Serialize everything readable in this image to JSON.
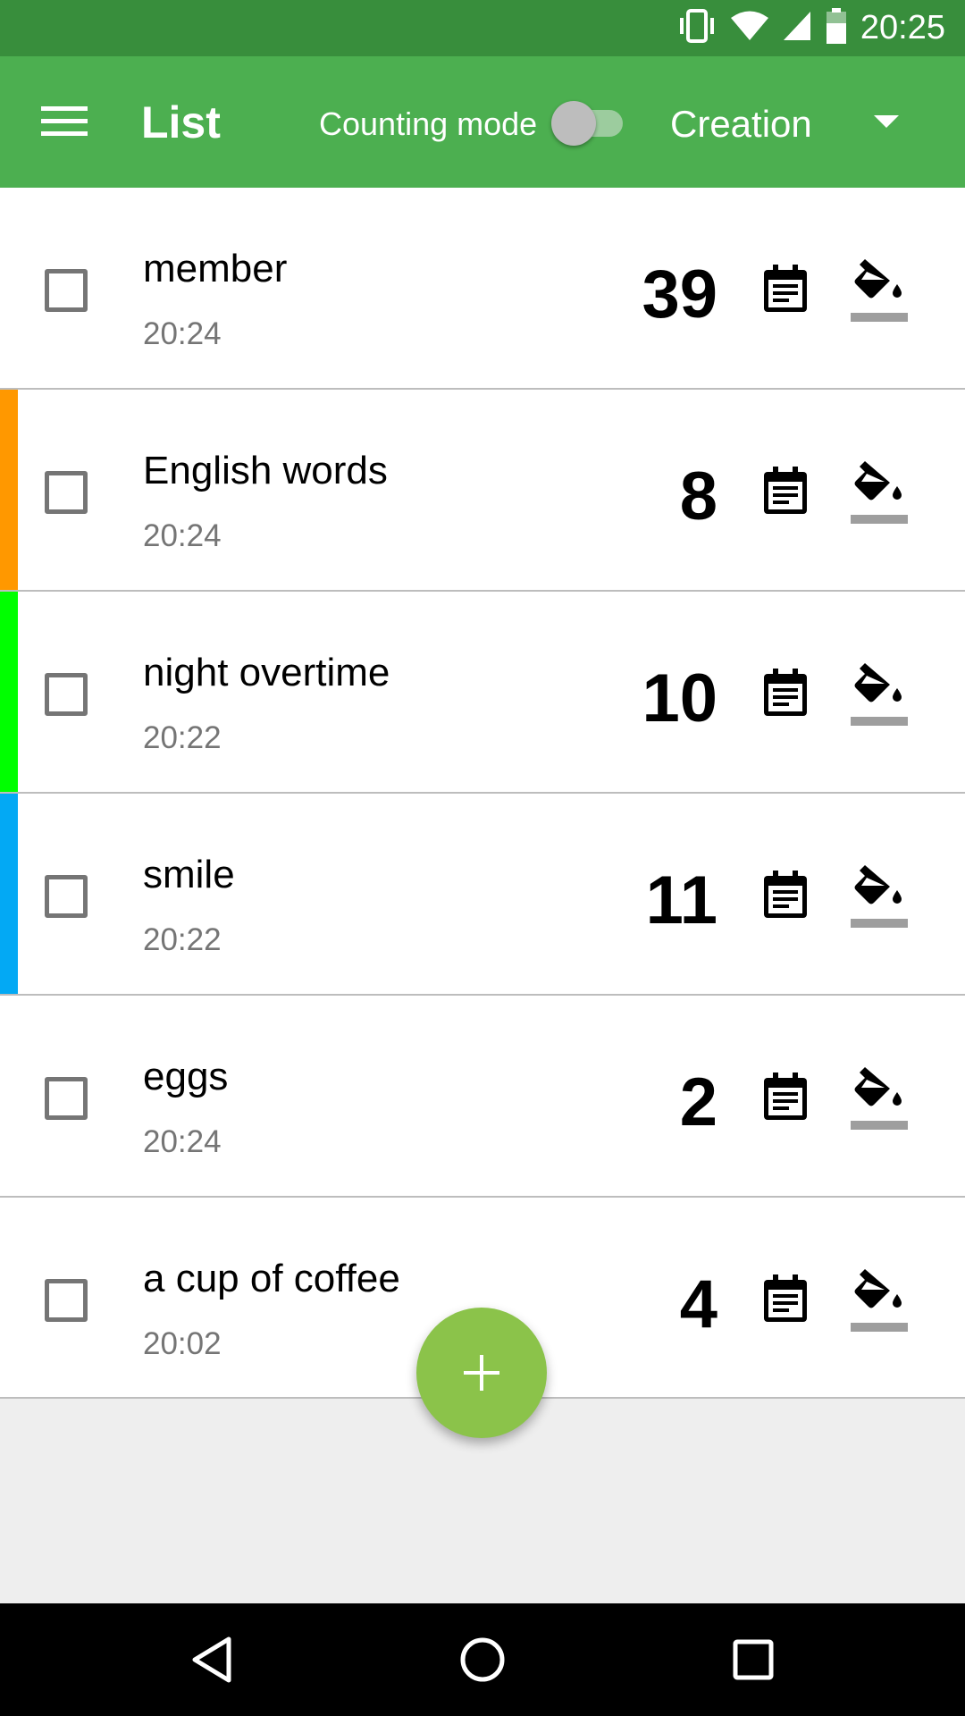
{
  "status_bar": {
    "time": "20:25",
    "icons": [
      "vibrate-icon",
      "wifi-icon",
      "signal-icon",
      "battery-icon"
    ]
  },
  "app_bar": {
    "menu_icon": "hamburger-menu-icon",
    "title": "List",
    "counting_mode_label": "Counting mode",
    "counting_mode_on": false,
    "sort_value": "Creation",
    "colors": {
      "status_bar": "#388e3c",
      "app_bar": "#4caf50"
    }
  },
  "items": [
    {
      "name": "member",
      "time": "20:24",
      "count": "39",
      "color": ""
    },
    {
      "name": "English words",
      "time": "20:24",
      "count": "8",
      "color": "#ff9800"
    },
    {
      "name": "night overtime",
      "time": "20:22",
      "count": "10",
      "color": "#00ff00"
    },
    {
      "name": "smile",
      "time": "20:22",
      "count": "11",
      "color": "#03a9f4"
    },
    {
      "name": "eggs",
      "time": "20:24",
      "count": "2",
      "color": ""
    },
    {
      "name": "a cup of coffee",
      "time": "20:02",
      "count": "4",
      "color": ""
    }
  ],
  "fab": {
    "icon": "plus-icon",
    "color": "#8bc34a"
  },
  "nav_bar": {
    "icons": [
      "back-icon",
      "home-icon",
      "recents-icon"
    ]
  }
}
